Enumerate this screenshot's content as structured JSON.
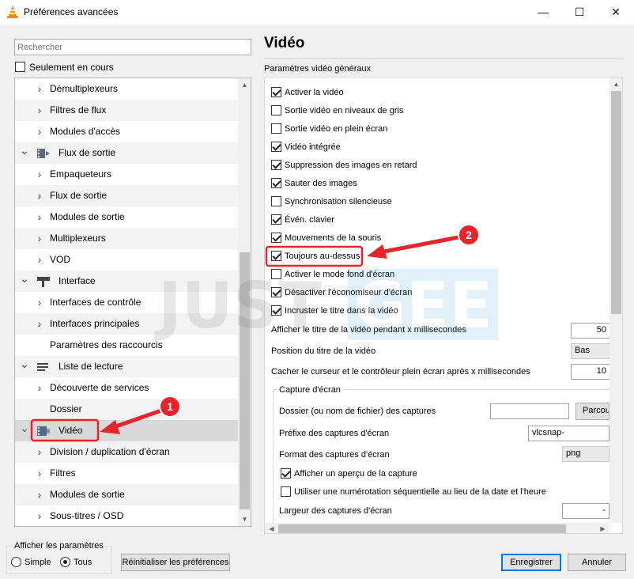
{
  "window": {
    "title": "Préférences avancées",
    "minimize_glyph": "—",
    "maximize_glyph": "☐",
    "close_glyph": "✕"
  },
  "left_panel": {
    "search_placeholder": "Rechercher",
    "only_current_label": "Seulement en cours",
    "only_current_checked": false,
    "tree": [
      {
        "label": "Démultiplexeurs",
        "level": 1
      },
      {
        "label": "Filtres de flux",
        "level": 1
      },
      {
        "label": "Modules d'accès",
        "level": 1
      },
      {
        "label": "Flux de sortie",
        "level": 0,
        "icon": "stream-output-icon"
      },
      {
        "label": "Empaqueteurs",
        "level": 1
      },
      {
        "label": "Flux de sortie",
        "level": 1
      },
      {
        "label": "Modules de sortie",
        "level": 1
      },
      {
        "label": "Multiplexeurs",
        "level": 1
      },
      {
        "label": "VOD",
        "level": 1
      },
      {
        "label": "Interface",
        "level": 0,
        "icon": "interface-icon"
      },
      {
        "label": "Interfaces de contrôle",
        "level": 1
      },
      {
        "label": "Interfaces principales",
        "level": 1
      },
      {
        "label": "Paramètres des raccourcis",
        "level": 1,
        "leaf": true
      },
      {
        "label": "Liste de lecture",
        "level": 0,
        "icon": "playlist-icon"
      },
      {
        "label": "Découverte de services",
        "level": 1
      },
      {
        "label": "Dossier",
        "level": 1,
        "leaf": true
      },
      {
        "label": "Vidéo",
        "level": 0,
        "icon": "video-icon",
        "selected": true
      },
      {
        "label": "Division / duplication d'écran",
        "level": 1
      },
      {
        "label": "Filtres",
        "level": 1
      },
      {
        "label": "Modules de sortie",
        "level": 1
      },
      {
        "label": "Sous-titres / OSD",
        "level": 1
      }
    ]
  },
  "right_panel": {
    "title": "Vidéo",
    "section_label": "Paramètres vidéo généraux",
    "checkboxes": [
      {
        "label": "Activer la vidéo",
        "checked": true
      },
      {
        "label": "Sortie vidéo en niveaux de gris",
        "checked": false
      },
      {
        "label": "Sortie vidéo en plein écran",
        "checked": false
      },
      {
        "label": "Vidéo intégrée",
        "checked": true
      },
      {
        "label": "Suppression des images en retard",
        "checked": true
      },
      {
        "label": "Sauter des images",
        "checked": true
      },
      {
        "label": "Synchronisation silencieuse",
        "checked": false
      },
      {
        "label": "Évén. clavier",
        "checked": true
      },
      {
        "label": "Mouvements de la souris",
        "checked": true
      },
      {
        "label": "Toujours au-dessus",
        "checked": true
      },
      {
        "label": "Activer le mode fond d'écran",
        "checked": false
      },
      {
        "label": "Désactiver l'économiseur d'écran",
        "checked": true
      },
      {
        "label": "Incruster le titre dans la vidéo",
        "checked": true
      }
    ],
    "title_duration_label": "Afficher le titre de la vidéo pendant x millisecondes",
    "title_duration_value": "50",
    "title_position_label": "Position du titre de la vidéo",
    "title_position_value": "Bas",
    "hide_cursor_label": "Cacher le curseur et le contrôleur plein écran après x millisecondes",
    "hide_cursor_value": "10",
    "capture": {
      "group_title": "Capture d'écran",
      "folder_label": "Dossier (ou nom de fichier) des captures",
      "folder_value": "",
      "browse_label": "Parcour",
      "prefix_label": "Préfixe des captures d'écran",
      "prefix_value": "vlcsnap-",
      "format_label": "Format des captures d'écran",
      "format_value": "png",
      "preview_label": "Afficher un aperçu de la capture",
      "preview_checked": true,
      "sequential_label": "Utiliser une numérotation séquentielle au lieu de la date et l'heure",
      "sequential_checked": false,
      "width_label": "Largeur des captures d'écran",
      "width_value": "-"
    }
  },
  "bottom": {
    "show_settings_title": "Afficher les paramètres",
    "simple_label": "Simple",
    "all_label": "Tous",
    "selected_mode": "Tous",
    "reset_label": "Réinitialiser les préférences",
    "save_label": "Enregistrer",
    "cancel_label": "Annuler"
  },
  "annotations": [
    {
      "number": "1",
      "target": "Vidéo"
    },
    {
      "number": "2",
      "target": "Toujours au-dessus"
    }
  ],
  "watermark": {
    "text": "JUSTGEEK"
  },
  "colors": {
    "annotation_red": "#e5252a",
    "selection_gray": "#d9d9d9",
    "primary_border": "#0078d7"
  }
}
